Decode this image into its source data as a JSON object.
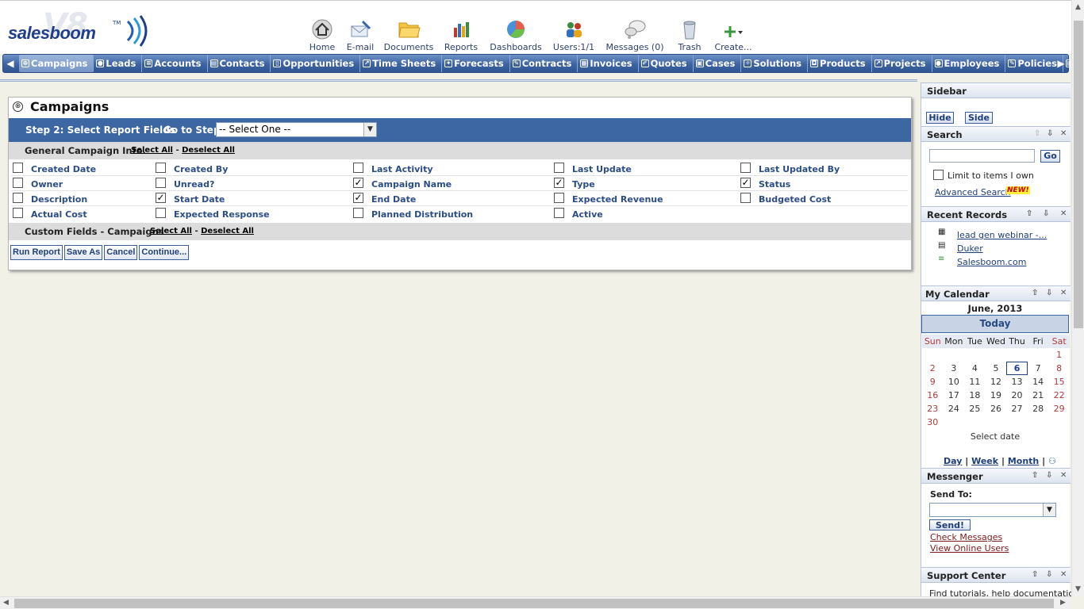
{
  "logo": {
    "brand": "salesboom",
    "tm": "TM",
    "version_watermark": "V8"
  },
  "toolbar": [
    {
      "label": "Home",
      "icon": "home-icon"
    },
    {
      "label": "E-mail",
      "icon": "email-icon"
    },
    {
      "label": "Documents",
      "icon": "folder-icon"
    },
    {
      "label": "Reports",
      "icon": "reports-icon"
    },
    {
      "label": "Dashboards",
      "icon": "dashboard-icon"
    },
    {
      "label": "Users:1/1",
      "icon": "users-icon"
    },
    {
      "label": "Messages (0)",
      "icon": "messages-icon"
    },
    {
      "label": "Trash",
      "icon": "trash-icon"
    },
    {
      "label": "Create...",
      "icon": "plus-icon"
    }
  ],
  "nav": {
    "items": [
      "Campaigns",
      "Leads",
      "Accounts",
      "Contacts",
      "Opportunities",
      "Time Sheets",
      "Forecasts",
      "Contracts",
      "Invoices",
      "Quotes",
      "Cases",
      "Solutions",
      "Products",
      "Projects",
      "Employees",
      "Policies"
    ],
    "active": "Campaigns"
  },
  "panel": {
    "title": "Campaigns",
    "step_label": "Step 2: Select Report Fields",
    "goto_label": "Go to Step:",
    "goto_value": "-- Select One --",
    "general_section": "General Campaign Info.",
    "custom_section": "Custom Fields - Campaigns",
    "select_all": "Select All",
    "separator": "-",
    "deselect_all": "Deselect All",
    "fields": [
      [
        {
          "label": "Created Date",
          "checked": false
        },
        {
          "label": "Created By",
          "checked": false
        },
        {
          "label": "Last Activity",
          "checked": false
        },
        {
          "label": "Last Update",
          "checked": false
        },
        {
          "label": "Last Updated By",
          "checked": false
        }
      ],
      [
        {
          "label": "Owner",
          "checked": false
        },
        {
          "label": "Unread?",
          "checked": false
        },
        {
          "label": "Campaign Name",
          "checked": true
        },
        {
          "label": "Type",
          "checked": true
        },
        {
          "label": "Status",
          "checked": true
        }
      ],
      [
        {
          "label": "Description",
          "checked": false
        },
        {
          "label": "Start Date",
          "checked": true
        },
        {
          "label": "End Date",
          "checked": true
        },
        {
          "label": "Expected Revenue",
          "checked": false
        },
        {
          "label": "Budgeted Cost",
          "checked": false
        }
      ],
      [
        {
          "label": "Actual Cost",
          "checked": false
        },
        {
          "label": "Expected Response",
          "checked": false
        },
        {
          "label": "Planned Distribution",
          "checked": false
        },
        {
          "label": "Active",
          "checked": false
        }
      ]
    ],
    "buttons": {
      "run_report": "Run Report",
      "save_as": "Save As",
      "cancel": "Cancel",
      "continue": "Continue..."
    }
  },
  "sidebar": {
    "title": "Sidebar",
    "hide": "Hide",
    "side": "Side",
    "search": {
      "title": "Search",
      "go": "Go",
      "limit_label": "Limit to items I own",
      "advanced": "Advanced Search",
      "new_badge": "NEW!"
    },
    "recent": {
      "title": "Recent Records",
      "items": [
        "lead gen webinar -...",
        "Duker",
        "Salesboom.com"
      ]
    },
    "calendar": {
      "title": "My Calendar",
      "month": "June, 2013",
      "today_label": "Today",
      "days": [
        "Sun",
        "Mon",
        "Tue",
        "Wed",
        "Thu",
        "Fri",
        "Sat"
      ],
      "weeks": [
        [
          "",
          "",
          "",
          "",
          "",
          "",
          "1"
        ],
        [
          "2",
          "3",
          "4",
          "5",
          "6",
          "7",
          "8"
        ],
        [
          "9",
          "10",
          "11",
          "12",
          "13",
          "14",
          "15"
        ],
        [
          "16",
          "17",
          "18",
          "19",
          "20",
          "21",
          "22"
        ],
        [
          "23",
          "24",
          "25",
          "26",
          "27",
          "28",
          "29"
        ],
        [
          "30",
          "",
          "",
          "",
          "",
          "",
          ""
        ]
      ],
      "today": "6",
      "select_date": "Select date",
      "day": "Day",
      "week": "Week",
      "month_link": "Month",
      "sep": "|"
    },
    "messenger": {
      "title": "Messenger",
      "send_to": "Send To:",
      "send": "Send!",
      "check": "Check Messages",
      "online": "View Online Users"
    },
    "support": {
      "title": "Support Center",
      "text": "Find tutorials, help documentation"
    }
  },
  "colors": {
    "nav_bg": "#3d63a2",
    "step_bar": "#3c67a3",
    "field_label": "#2b4d86",
    "page_bg": "#f2f1e8",
    "weekend": "#b03a3a"
  }
}
